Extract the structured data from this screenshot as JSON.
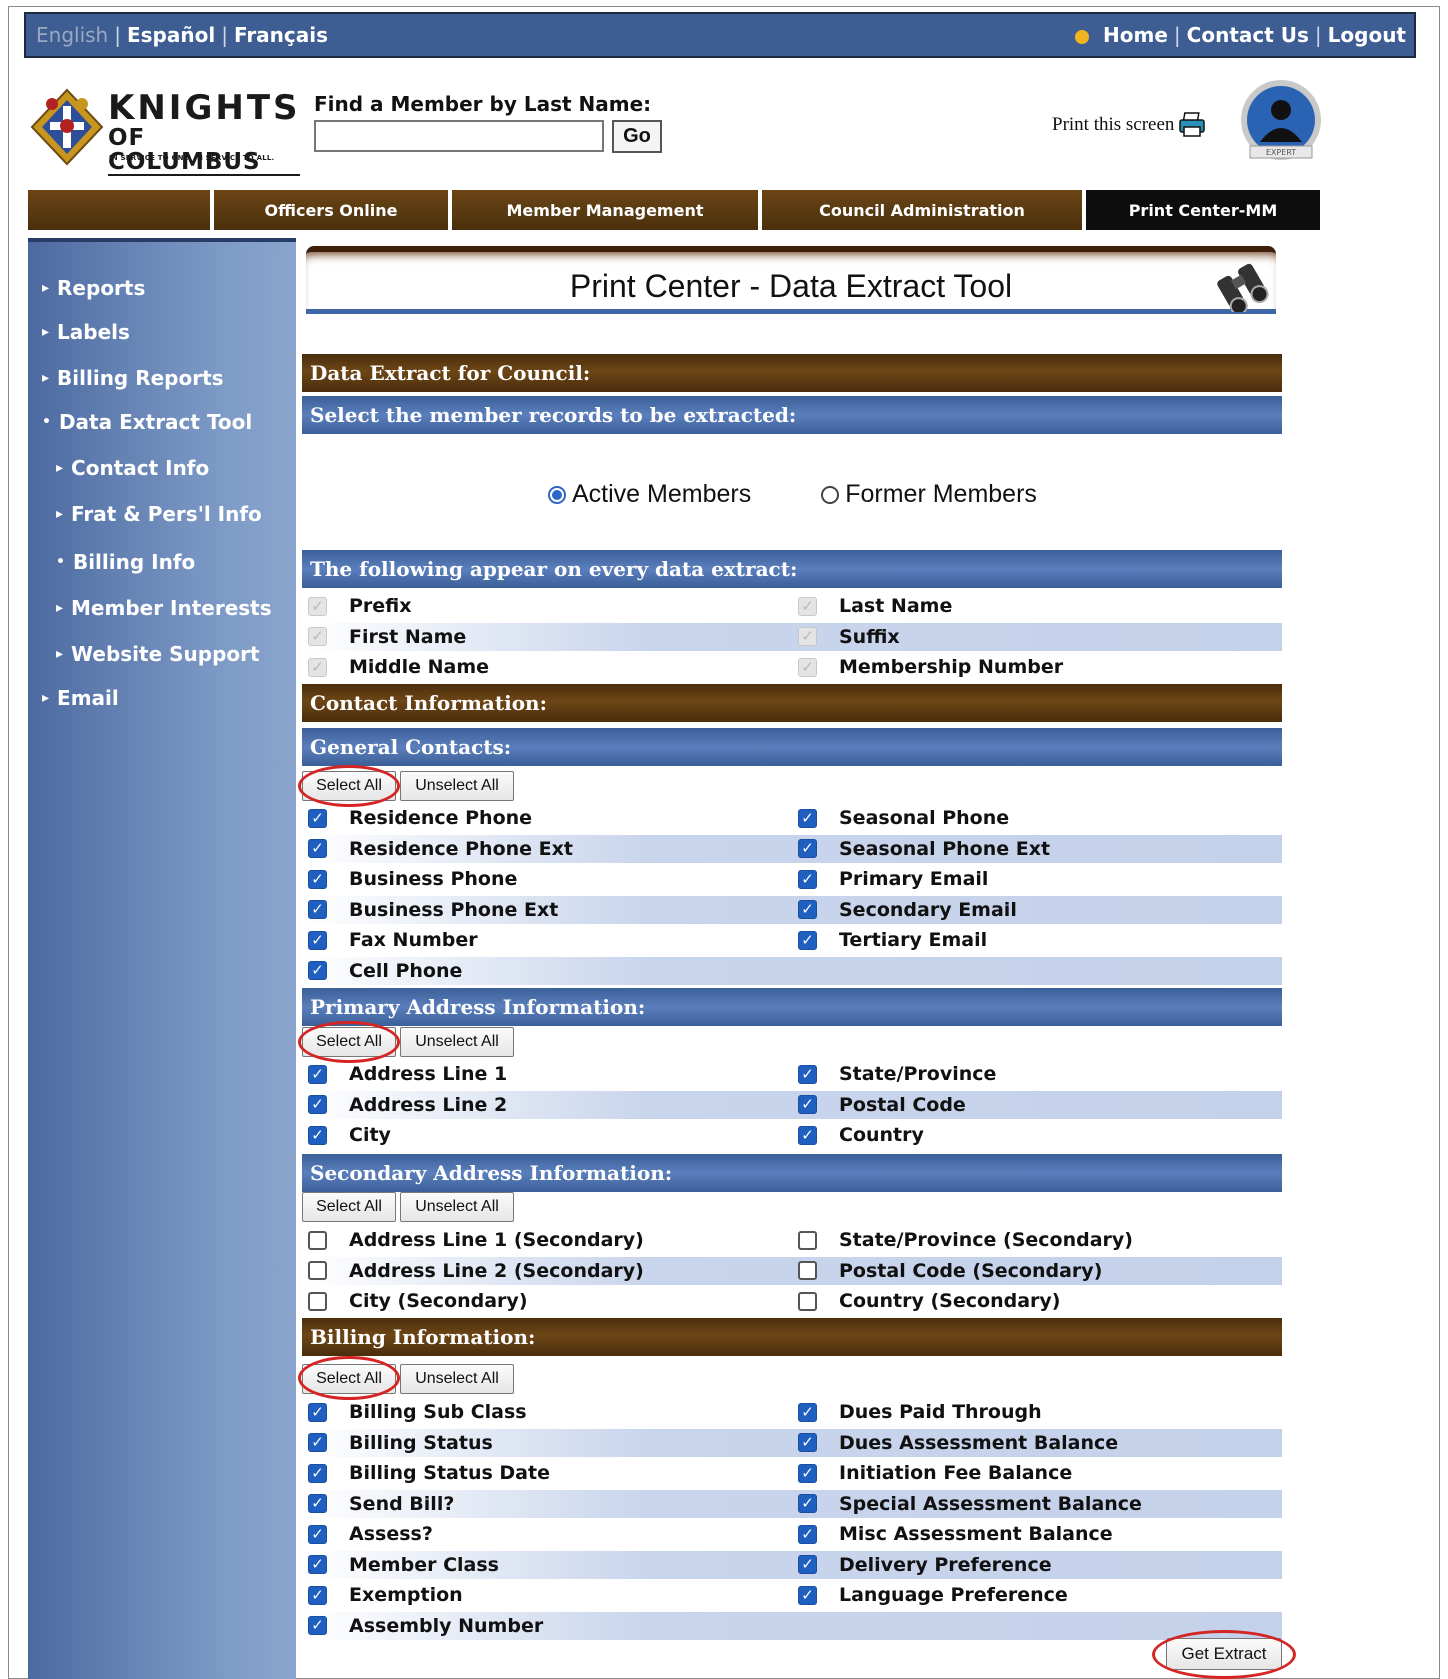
{
  "topbar": {
    "languages": [
      "English",
      "Español",
      "Français"
    ],
    "links": [
      "Home",
      "Contact Us",
      "Logout"
    ]
  },
  "logo": {
    "line1": "KNIGHTS",
    "line2": "OF COLUMBUS",
    "tagline": "IN SERVICE TO ONE. IN SERVICE TO ALL."
  },
  "search": {
    "label": "Find a Member by Last Name:",
    "value": "",
    "button": "Go"
  },
  "print_screen": "Print this screen",
  "avatar_badge": "EXPERT",
  "nav": {
    "tabs": [
      "",
      "Officers Online",
      "Member Management",
      "Council Administration",
      "Print Center-MM"
    ],
    "active": "Print Center-MM"
  },
  "sidebar": {
    "items": [
      {
        "label": "Reports",
        "marker": "▸"
      },
      {
        "label": "Labels",
        "marker": "▸"
      },
      {
        "label": "Billing Reports",
        "marker": "▸"
      },
      {
        "label": "Data Extract Tool",
        "marker": "•"
      },
      {
        "label": "Contact Info",
        "marker": "▸"
      },
      {
        "label": "Frat & Pers'l Info",
        "marker": "▸"
      },
      {
        "label": "Billing Info",
        "marker": "•"
      },
      {
        "label": "Member Interests",
        "marker": "▸"
      },
      {
        "label": "Website Support",
        "marker": "▸"
      },
      {
        "label": "Email",
        "marker": "▸"
      }
    ]
  },
  "main": {
    "title": "Print Center - Data Extract Tool",
    "extract_for": "Data Extract for Council:",
    "select_records": "Select the member records to be extracted:",
    "radio": {
      "active": "Active Members",
      "former": "Former Members",
      "selected": "active"
    },
    "always_header": "The following appear on every data extract:",
    "always_fields": {
      "left": [
        "Prefix",
        "First Name",
        "Middle Name"
      ],
      "right": [
        "Last Name",
        "Suffix",
        "Membership Number"
      ]
    },
    "contact_header": "Contact Information:",
    "select_all": "Select All",
    "unselect_all": "Unselect All",
    "general": {
      "header": "General Contacts:",
      "left": [
        "Residence Phone",
        "Residence Phone Ext",
        "Business Phone",
        "Business Phone Ext",
        "Fax Number",
        "Cell Phone"
      ],
      "right": [
        "Seasonal Phone",
        "Seasonal Phone Ext",
        "Primary Email",
        "Secondary Email",
        "Tertiary Email"
      ],
      "checked": true
    },
    "primary": {
      "header": "Primary Address Information:",
      "left": [
        "Address Line 1",
        "Address Line 2",
        "City"
      ],
      "right": [
        "State/Province",
        "Postal Code",
        "Country"
      ],
      "checked": true
    },
    "secondary": {
      "header": "Secondary Address Information:",
      "left": [
        "Address Line 1 (Secondary)",
        "Address Line 2 (Secondary)",
        "City (Secondary)"
      ],
      "right": [
        "State/Province (Secondary)",
        "Postal Code (Secondary)",
        "Country (Secondary)"
      ],
      "checked": false
    },
    "billing": {
      "header": "Billing Information:",
      "left": [
        "Billing Sub Class",
        "Billing Status",
        "Billing Status Date",
        "Send Bill?",
        "Assess?",
        "Member Class",
        "Exemption",
        "Assembly Number"
      ],
      "right": [
        "Dues Paid Through",
        "Dues Assessment Balance",
        "Initiation Fee Balance",
        "Special Assessment Balance",
        "Misc Assessment Balance",
        "Delivery Preference",
        "Language Preference"
      ],
      "checked": true
    },
    "get_extract": "Get Extract"
  }
}
